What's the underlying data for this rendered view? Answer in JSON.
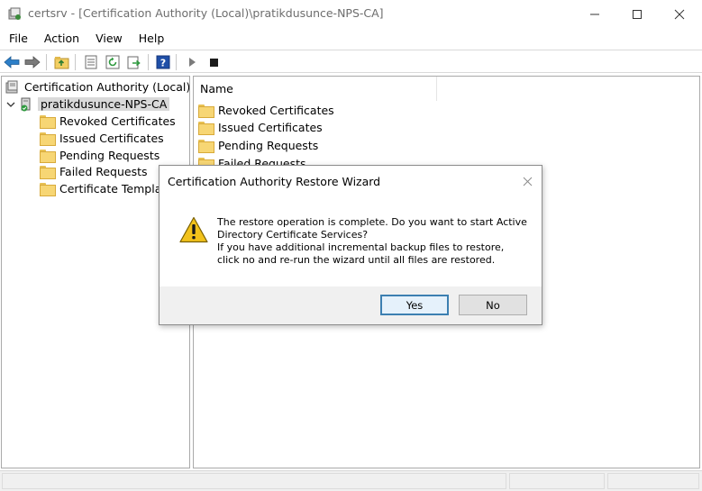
{
  "window": {
    "title": "certsrv - [Certification Authority (Local)\\pratikdusunce-NPS-CA]",
    "minimize_glyph": "—",
    "maximize_glyph": "☐",
    "close_glyph": "✕"
  },
  "menu": {
    "file": "File",
    "action": "Action",
    "view": "View",
    "help": "Help"
  },
  "toolbar": {
    "icons": [
      "back-icon",
      "forward-icon",
      "up-folder-icon",
      "properties-icon",
      "refresh-icon",
      "export-icon",
      "help-icon",
      "start-service-icon",
      "stop-service-icon"
    ]
  },
  "tree": {
    "root": "Certification Authority (Local)",
    "ca_node": "pratikdusunce-NPS-CA",
    "children": [
      "Revoked Certificates",
      "Issued Certificates",
      "Pending Requests",
      "Failed Requests",
      "Certificate Template"
    ]
  },
  "content": {
    "column_name": "Name",
    "items": [
      "Revoked Certificates",
      "Issued Certificates",
      "Pending Requests",
      "Failed Requests"
    ]
  },
  "dialog": {
    "title": "Certification Authority Restore Wizard",
    "message_lines": [
      "The restore operation is complete. Do you want to start Active",
      "Directory Certificate Services?",
      "If you have additional incremental backup files to restore,",
      "click no and re-run the wizard until all files are restored."
    ],
    "yes_label": "Yes",
    "no_label": "No",
    "close_glyph": "✕"
  },
  "colors": {
    "accent": "#3c7fb1",
    "folder": "#f7d674",
    "warning": "#f2c21b"
  }
}
